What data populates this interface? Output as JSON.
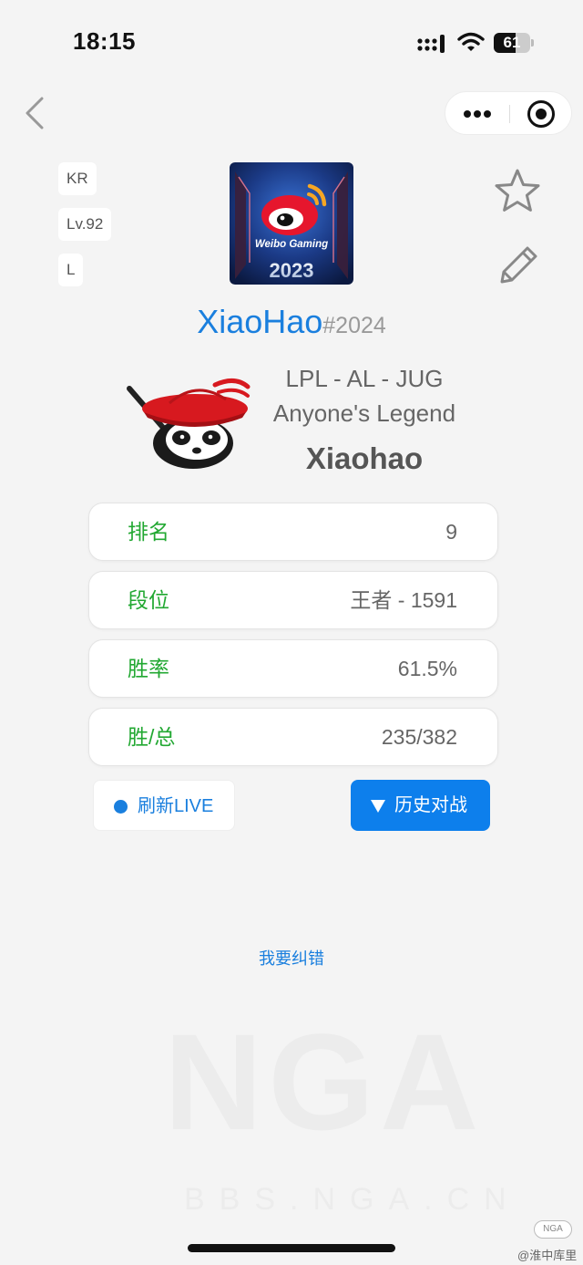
{
  "status_bar": {
    "time": "18:15",
    "battery": "61",
    "battery_level": 0.61
  },
  "tags": [
    "KR",
    "Lv.92",
    "L"
  ],
  "team_logo": {
    "brand": "Weibo Gaming",
    "year": "2023",
    "icon": "weibo-logo-icon"
  },
  "player": {
    "name": "XiaoHao",
    "tag": "#2024",
    "league_line": "LPL - AL - JUG",
    "team_name": "Anyone's Legend",
    "real_name": "Xiaohao"
  },
  "stats": [
    {
      "label": "排名",
      "value": "9"
    },
    {
      "label": "段位",
      "value": "王者 - 1591"
    },
    {
      "label": "胜率",
      "value": "61.5%"
    },
    {
      "label": "胜/总",
      "value": "235/382"
    }
  ],
  "buttons": {
    "refresh": "刷新LIVE",
    "history": "历史对战"
  },
  "report_link": "我要纠错",
  "watermark": {
    "big": "NGA",
    "small": "BBS.NGA.CN"
  },
  "credit": {
    "logo": "NGA",
    "text": "@淮中库里"
  },
  "colors": {
    "accent": "#1a7fde",
    "button_blue": "#0d7fec",
    "stat_label": "#22a832",
    "background": "#f4f4f4"
  }
}
